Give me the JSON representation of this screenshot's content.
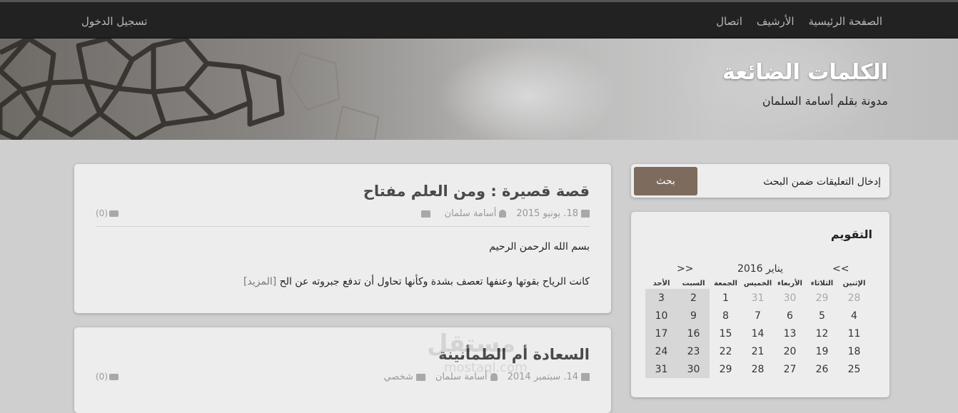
{
  "nav": {
    "items": [
      {
        "label": "الصفحة الرئيسية"
      },
      {
        "label": "الأرشيف"
      },
      {
        "label": "اتصال"
      }
    ],
    "login": "تسجيل الدخول"
  },
  "header": {
    "title": "الكلمات الضائعة",
    "subtitle": "مدونة بقلم أسامة السلمان"
  },
  "posts": [
    {
      "title": "قصة قصيرة : ومن العلم مفتاح",
      "date": "18. يونيو 2015",
      "author": "أسامة سلمان",
      "category": "",
      "comments": "(0)",
      "para1": "بسم الله الرحمن الرحيم",
      "para2": "كانت الرياح بقوتها وعنفها تعصف بشدة وكأنها تحاول أن تدفع جبروته عن الح",
      "more": "[المزيد]"
    },
    {
      "title": "السعادة أم الطمأنينة",
      "date": "14. سبتمبر 2014",
      "author": "أسامة سلمان",
      "category": "شخصي",
      "comments": "(0)"
    }
  ],
  "search": {
    "placeholder": "إدخال التعليقات ضمن البحث",
    "button": "بحث"
  },
  "calendar": {
    "heading": "التقويم",
    "month": "يناير 2016",
    "prev": "<<",
    "next": ">>",
    "weekdays": [
      "الإثنين",
      "الثلاثاء",
      "الأربعاء",
      "الخميس",
      "الجمعة",
      "السبت",
      "الأحد"
    ],
    "weeks": [
      [
        "28",
        "29",
        "30",
        "31",
        "1",
        "2",
        "3"
      ],
      [
        "4",
        "5",
        "6",
        "7",
        "8",
        "9",
        "10"
      ],
      [
        "11",
        "12",
        "13",
        "14",
        "15",
        "16",
        "17"
      ],
      [
        "18",
        "19",
        "20",
        "21",
        "22",
        "23",
        "24"
      ],
      [
        "25",
        "26",
        "27",
        "28",
        "29",
        "30",
        "31"
      ]
    ]
  },
  "watermark": {
    "arabic": "مستقل",
    "latin": "mostaql.com"
  },
  "colors": {
    "topbar": "#222222",
    "button": "#7d6b5d",
    "panel": "#ededed",
    "background": "#cfcfcf"
  }
}
